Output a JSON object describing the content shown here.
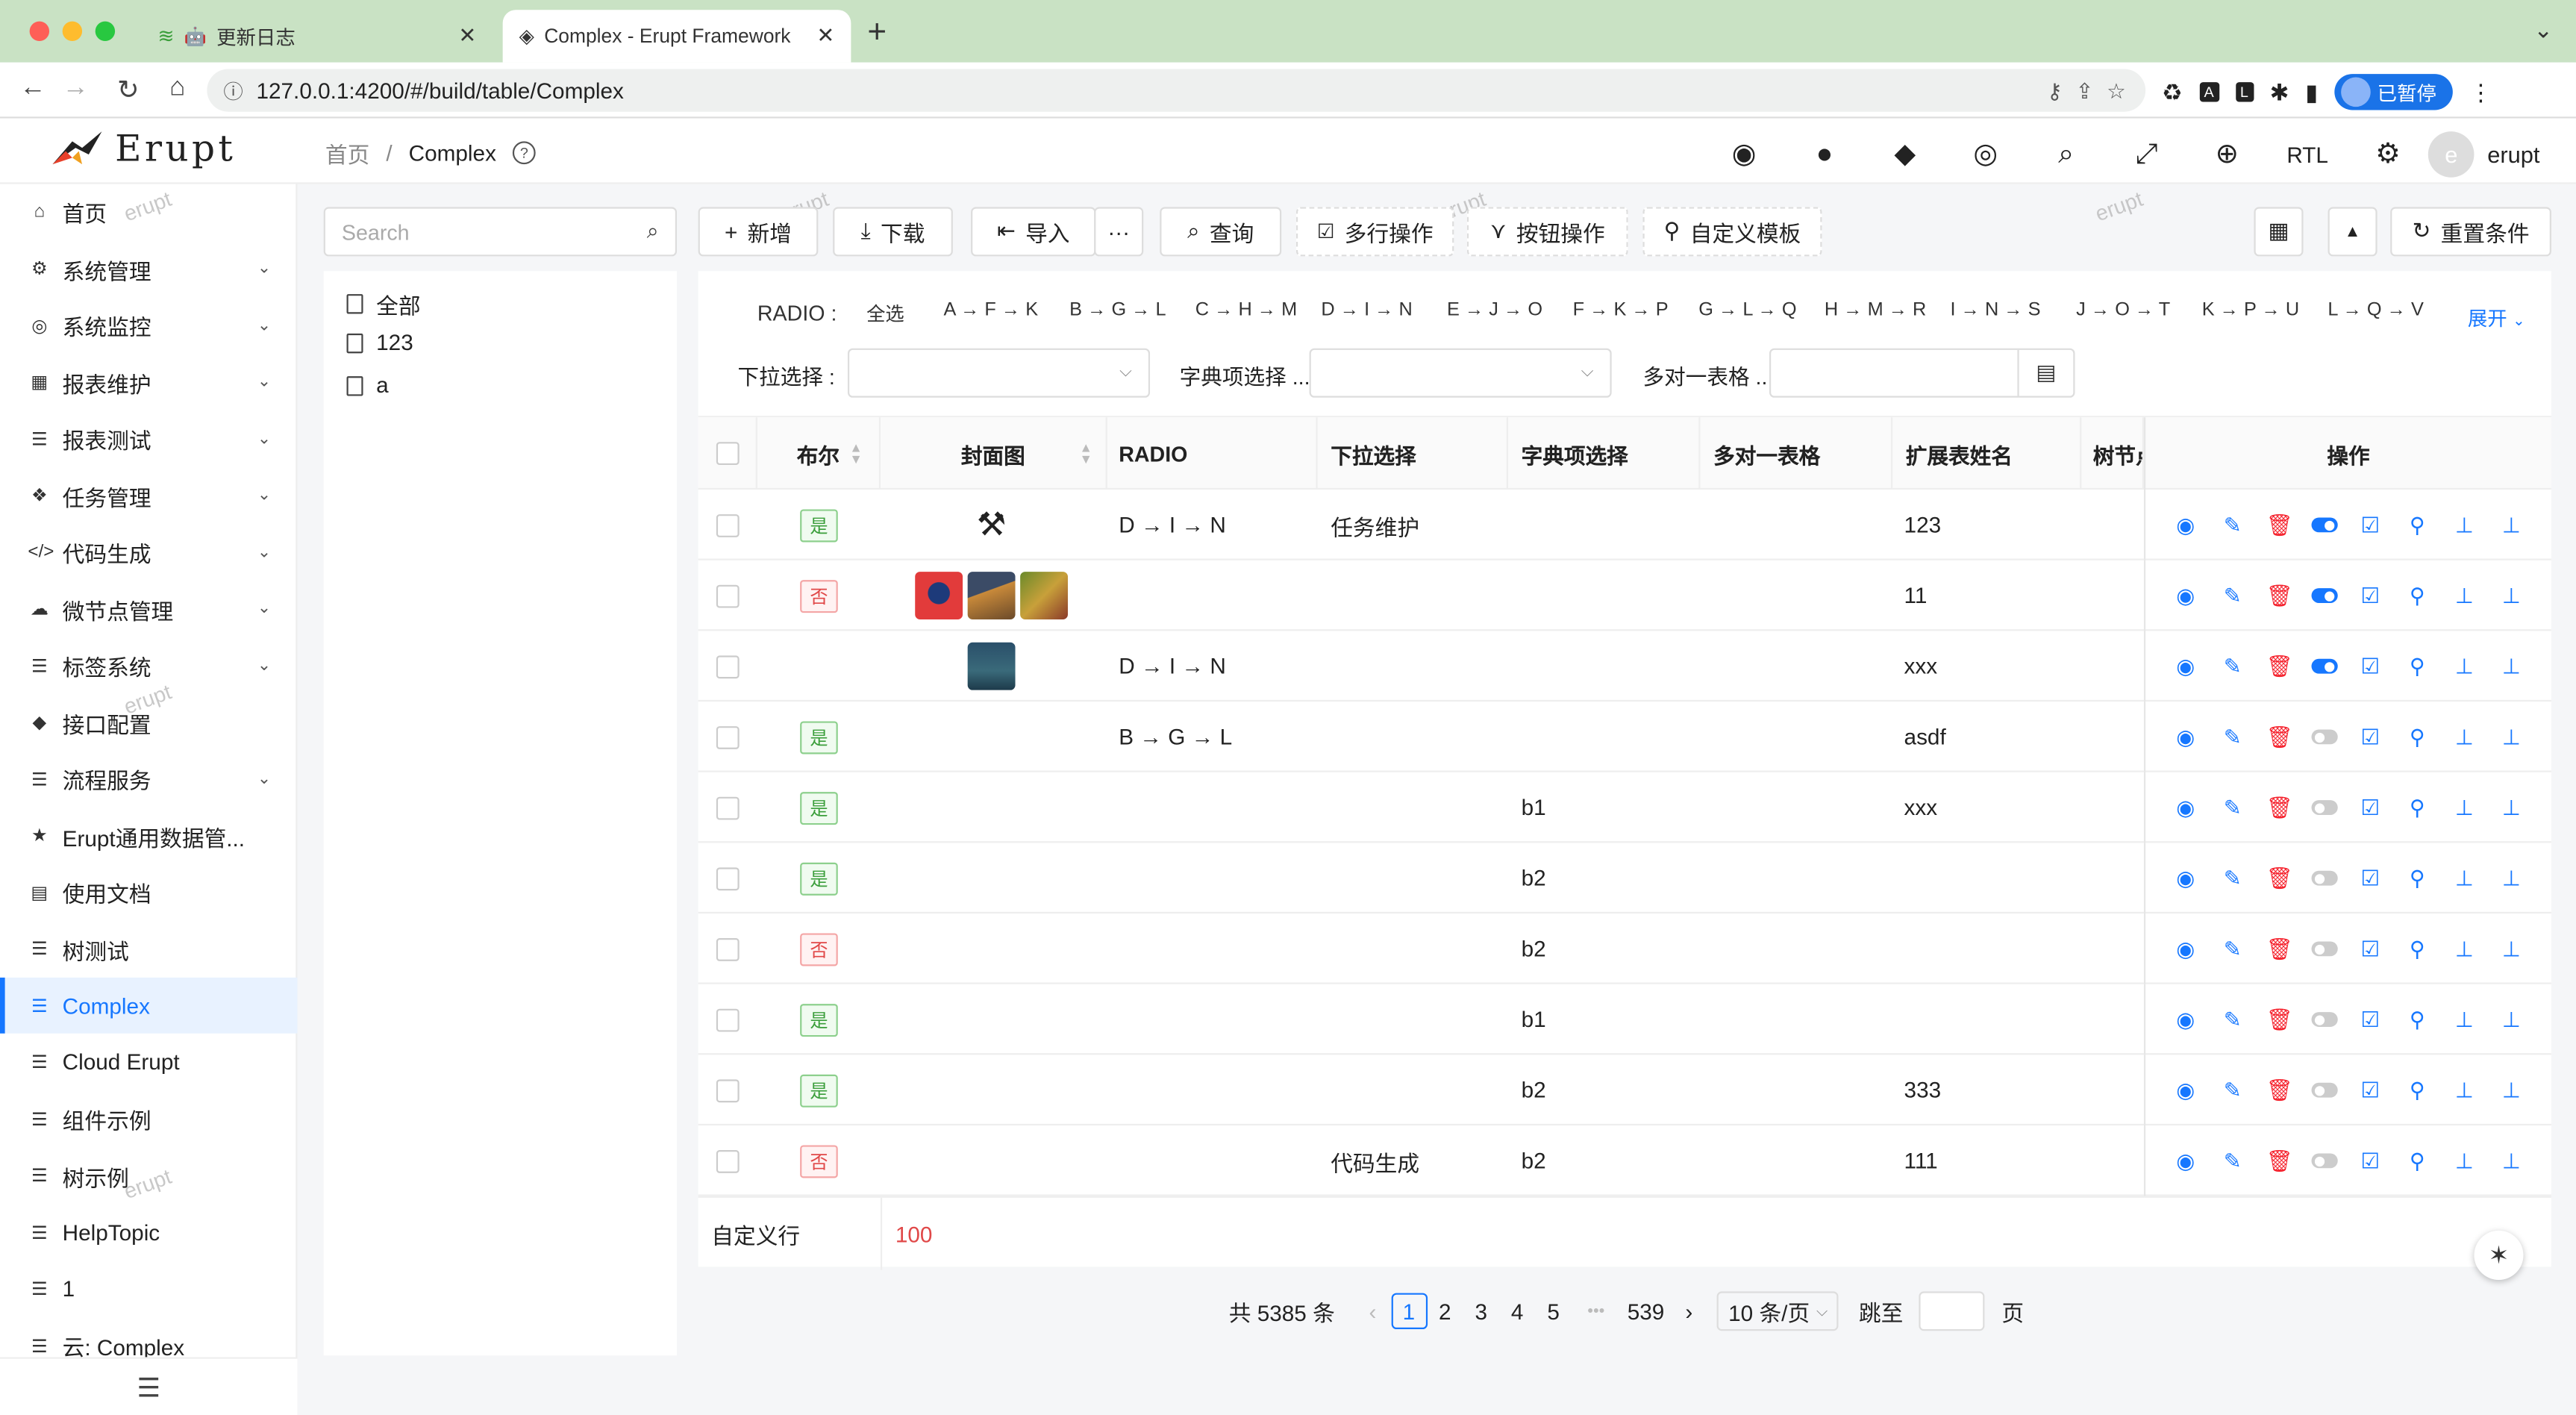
{
  "browser": {
    "tabs": [
      {
        "title": "更新日志"
      },
      {
        "title": "Complex - Erupt Framework"
      }
    ],
    "url": "127.0.0.1:4200/#/build/table/Complex",
    "profile_status": "已暂停"
  },
  "app": {
    "logo_text": "Erupt",
    "breadcrumb": {
      "home": "首页",
      "separator": "/",
      "current": "Complex"
    },
    "top_right": {
      "rtl_label": "RTL",
      "user_initial": "e",
      "username": "erupt"
    },
    "watermark": "erupt"
  },
  "sidebar": {
    "items": [
      {
        "label": "首页",
        "icon": "home-icon",
        "has_children": false
      },
      {
        "label": "系统管理",
        "icon": "cogs-icon",
        "has_children": true
      },
      {
        "label": "系统监控",
        "icon": "dashboard-icon",
        "has_children": true
      },
      {
        "label": "报表维护",
        "icon": "table-icon",
        "has_children": true
      },
      {
        "label": "报表测试",
        "icon": "list-icon",
        "has_children": true
      },
      {
        "label": "任务管理",
        "icon": "cubes-icon",
        "has_children": true
      },
      {
        "label": "代码生成",
        "icon": "code-icon",
        "has_children": true
      },
      {
        "label": "微节点管理",
        "icon": "cloud-icon",
        "has_children": true
      },
      {
        "label": "标签系统",
        "icon": "list-icon",
        "has_children": true
      },
      {
        "label": "接口配置",
        "icon": "cube-icon",
        "has_children": false
      },
      {
        "label": "流程服务",
        "icon": "list-icon",
        "has_children": true
      },
      {
        "label": "Erupt通用数据管...",
        "icon": "star-icon",
        "has_children": false
      },
      {
        "label": "使用文档",
        "icon": "book-icon",
        "has_children": false
      },
      {
        "label": "树测试",
        "icon": "list-icon",
        "has_children": false
      },
      {
        "label": "Complex",
        "icon": "list-icon",
        "has_children": false,
        "active": true
      },
      {
        "label": "Cloud Erupt",
        "icon": "list-icon",
        "has_children": false
      },
      {
        "label": "组件示例",
        "icon": "list-icon",
        "has_children": false
      },
      {
        "label": "树示例",
        "icon": "list-icon",
        "has_children": false
      },
      {
        "label": "HelpTopic",
        "icon": "list-icon",
        "has_children": false
      },
      {
        "label": "1",
        "icon": "list-icon",
        "has_children": false
      },
      {
        "label": "云: Complex",
        "icon": "list-icon",
        "has_children": false
      }
    ]
  },
  "tree_panel": {
    "search_placeholder": "Search",
    "items": [
      "全部",
      "123",
      "a"
    ]
  },
  "toolbar": {
    "add": "新增",
    "download": "下载",
    "import": "导入",
    "more": "···",
    "query": "查询",
    "multi_row": "多行操作",
    "button_op": "按钮操作",
    "custom_template": "自定义模板",
    "reset": "重置条件"
  },
  "filters": {
    "radio_label": "RADIO :",
    "radio_options": [
      "全选",
      "A → F → K",
      "B → G → L",
      "C → H → M",
      "D → I → N",
      "E → J → O",
      "F → K → P",
      "G → L → Q",
      "H → M → R",
      "I → N → S",
      "J → O → T",
      "K → P → U",
      "L → Q → V"
    ],
    "expand": "展开",
    "select_label": "下拉选择 :",
    "dict_label": "字典项选择 ...",
    "m2m_label": "多对一表格 ..."
  },
  "table": {
    "columns": [
      "布尔",
      "封面图",
      "RADIO",
      "下拉选择",
      "字典项选择",
      "多对一表格",
      "扩展表姓名",
      "树节点",
      "操作"
    ],
    "rows": [
      {
        "bool": "是",
        "bool_yes": true,
        "cover": [
          "tools"
        ],
        "radio": "D → I → N",
        "select": "任务维护",
        "dict": "",
        "m2m": "",
        "ext": "123",
        "toggle_on": true
      },
      {
        "bool": "否",
        "bool_yes": false,
        "cover": [
          "avatar",
          "pyramid",
          "game"
        ],
        "radio": "",
        "select": "",
        "dict": "",
        "m2m": "",
        "ext": "11",
        "toggle_on": true
      },
      {
        "bool": "",
        "bool_yes": null,
        "cover": [
          "plane"
        ],
        "radio": "D → I → N",
        "select": "",
        "dict": "",
        "m2m": "",
        "ext": "xxx",
        "toggle_on": true
      },
      {
        "bool": "是",
        "bool_yes": true,
        "cover": [],
        "radio": "B → G → L",
        "select": "",
        "dict": "",
        "m2m": "",
        "ext": "asdf",
        "toggle_on": false
      },
      {
        "bool": "是",
        "bool_yes": true,
        "cover": [],
        "radio": "",
        "select": "",
        "dict": "b1",
        "m2m": "",
        "ext": "xxx",
        "toggle_on": false
      },
      {
        "bool": "是",
        "bool_yes": true,
        "cover": [],
        "radio": "",
        "select": "",
        "dict": "b2",
        "m2m": "",
        "ext": "",
        "toggle_on": false
      },
      {
        "bool": "否",
        "bool_yes": false,
        "cover": [],
        "radio": "",
        "select": "",
        "dict": "b2",
        "m2m": "",
        "ext": "",
        "toggle_on": false
      },
      {
        "bool": "是",
        "bool_yes": true,
        "cover": [],
        "radio": "",
        "select": "",
        "dict": "b1",
        "m2m": "",
        "ext": "",
        "toggle_on": false
      },
      {
        "bool": "是",
        "bool_yes": true,
        "cover": [],
        "radio": "",
        "select": "",
        "dict": "b2",
        "m2m": "",
        "ext": "333",
        "toggle_on": false
      },
      {
        "bool": "否",
        "bool_yes": false,
        "cover": [],
        "radio": "",
        "select": "代码生成",
        "dict": "b2",
        "m2m": "",
        "ext": "111",
        "toggle_on": false
      }
    ],
    "summary_label": "自定义行",
    "summary_value": "100"
  },
  "pagination": {
    "total": "共 5385 条",
    "pages": [
      "1",
      "2",
      "3",
      "4",
      "5"
    ],
    "ellipsis": "•••",
    "last": "539",
    "page_size": "10 条/页",
    "jump_label": "跳至",
    "page_suffix": "页"
  },
  "colors": {
    "primary": "#1677ff",
    "danger": "#f5222d",
    "success": "#3a9e3a",
    "tab_bar": "#c9e2c4"
  }
}
